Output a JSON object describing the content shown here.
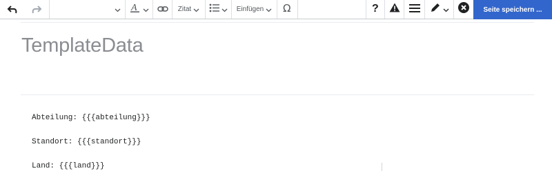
{
  "toolbar": {
    "undo_icon": "undo-icon",
    "redo_icon": "redo-icon",
    "paragraph_format_value": "",
    "text_style_icon": "text-style-icon",
    "link_icon": "link-icon",
    "cite_label": "Zitat",
    "list_icon": "bullet-list-icon",
    "insert_label": "Einfügen",
    "special_char_icon": "omega-icon",
    "help_icon": "help-icon",
    "notices_icon": "warning-icon",
    "page_options_icon": "menu-icon",
    "edit_mode_icon": "pencil-icon",
    "cancel_icon": "close-icon",
    "save_label": "Seite speichern ..."
  },
  "page": {
    "title": "TemplateData"
  },
  "params": [
    "Abteilung: {{{abteilung}}}",
    "Standort: {{{standort}}}",
    "Land: {{{land}}}"
  ],
  "colors": {
    "accent": "#3366cc",
    "title": "#8a8d91"
  }
}
